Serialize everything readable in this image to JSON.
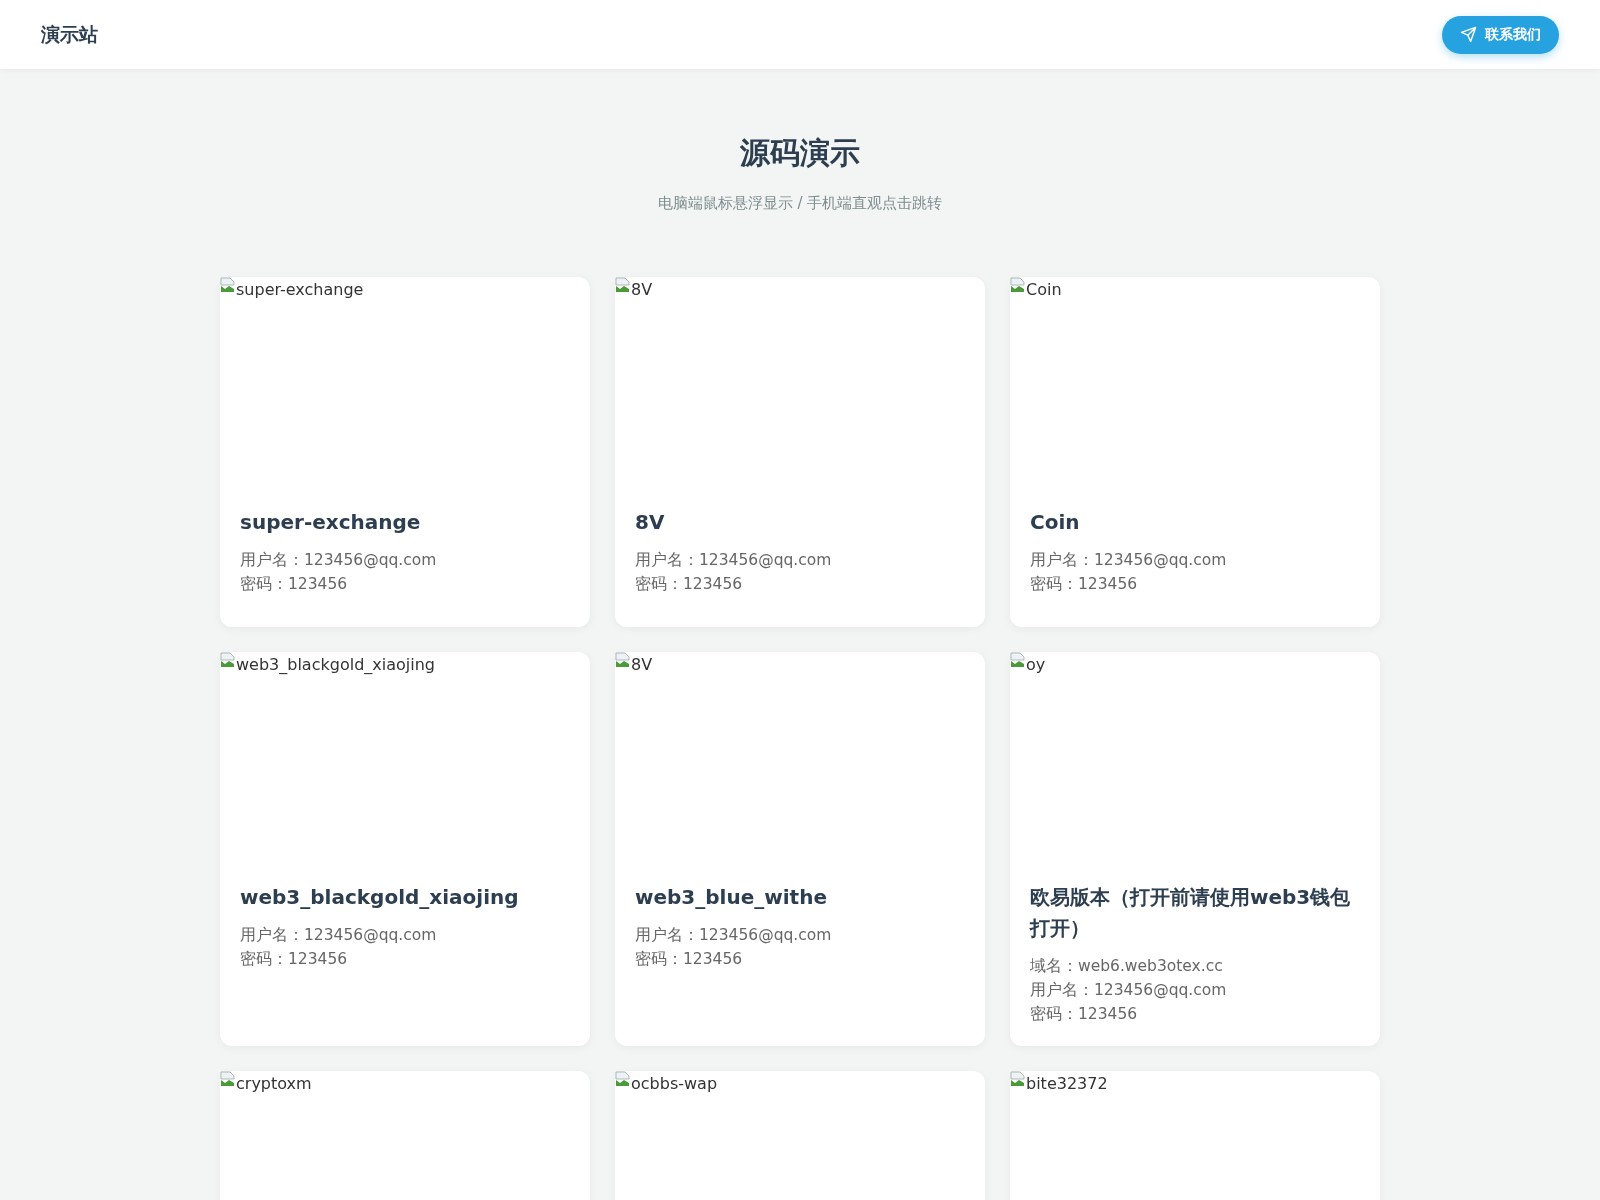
{
  "header": {
    "site_name": "演示站",
    "contact_button": "联系我们"
  },
  "hero": {
    "title": "源码演示",
    "subtitle": "电脑端鼠标悬浮显示 / 手机端直观点击跳转"
  },
  "cards": [
    {
      "image_alt": "super-exchange",
      "title": "super-exchange",
      "lines": [
        "用户名：123456@qq.com",
        "密码：123456"
      ]
    },
    {
      "image_alt": "8V",
      "title": "8V",
      "lines": [
        "用户名：123456@qq.com",
        "密码：123456"
      ]
    },
    {
      "image_alt": "Coin",
      "title": "Coin",
      "lines": [
        "用户名：123456@qq.com",
        "密码：123456"
      ]
    },
    {
      "image_alt": "web3_blackgold_xiaojing",
      "title": "web3_blackgold_xiaojing",
      "lines": [
        "用户名：123456@qq.com",
        "密码：123456"
      ]
    },
    {
      "image_alt": "8V",
      "title": "web3_blue_withe",
      "lines": [
        "用户名：123456@qq.com",
        "密码：123456"
      ]
    },
    {
      "image_alt": "oy",
      "title": "欧易版本（打开前请使用web3钱包打开）",
      "lines": [
        "域名：web6.web3otex.cc",
        "用户名：123456@qq.com",
        "密码：123456"
      ]
    },
    {
      "image_alt": "cryptoxm"
    },
    {
      "image_alt": "ocbbs-wap"
    },
    {
      "image_alt": "bite32372"
    }
  ]
}
